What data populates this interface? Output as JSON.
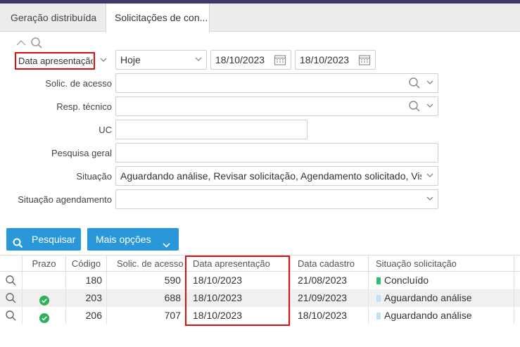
{
  "tabs": [
    {
      "label": "Geração distribuída"
    },
    {
      "label": "Solicitações de con..."
    }
  ],
  "filters": {
    "date_type": "Data apresentação",
    "period": "Hoje",
    "date_from": "18/10/2023",
    "date_to": "18/10/2023",
    "solic_acesso": {
      "label": "Solic. de acesso",
      "value": ""
    },
    "resp_tecnico": {
      "label": "Resp. técnico",
      "value": ""
    },
    "uc": {
      "label": "UC",
      "value": ""
    },
    "pesquisa_geral": {
      "label": "Pesquisa geral",
      "value": ""
    },
    "situacao": {
      "label": "Situação",
      "value": "Aguardando análise, Revisar solicitação, Agendamento solicitado, Vistoria solicitada"
    },
    "situacao_agendamento": {
      "label": "Situação agendamento",
      "value": ""
    }
  },
  "buttons": {
    "search": "Pesquisar",
    "more": "Mais opções"
  },
  "grid": {
    "headers": [
      "Prazo",
      "Código",
      "Solic. de acesso",
      "Data apresentação",
      "Data cadastro",
      "Situação solicitação"
    ],
    "rows": [
      {
        "prazo_ok": false,
        "codigo": "180",
        "solic": "590",
        "data_apresentacao": "18/10/2023",
        "data_cadastro": "21/08/2023",
        "situacao": "Concluído",
        "status_color": "#2fbf71"
      },
      {
        "prazo_ok": true,
        "codigo": "203",
        "solic": "688",
        "data_apresentacao": "18/10/2023",
        "data_cadastro": "21/09/2023",
        "situacao": "Aguardando análise",
        "status_color": "#bfe1f5"
      },
      {
        "prazo_ok": true,
        "codigo": "206",
        "solic": "707",
        "data_apresentacao": "18/10/2023",
        "data_cadastro": "18/10/2023",
        "situacao": "Aguardando análise",
        "status_color": "#bfe1f5"
      }
    ]
  },
  "colors": {
    "accent": "#2a97d8",
    "highlight": "#dd1111",
    "check": "#2fb15a"
  },
  "icons": [
    "search-icon",
    "collapse-icon",
    "chevron-down-icon",
    "calendar-icon",
    "check-circle-icon"
  ]
}
